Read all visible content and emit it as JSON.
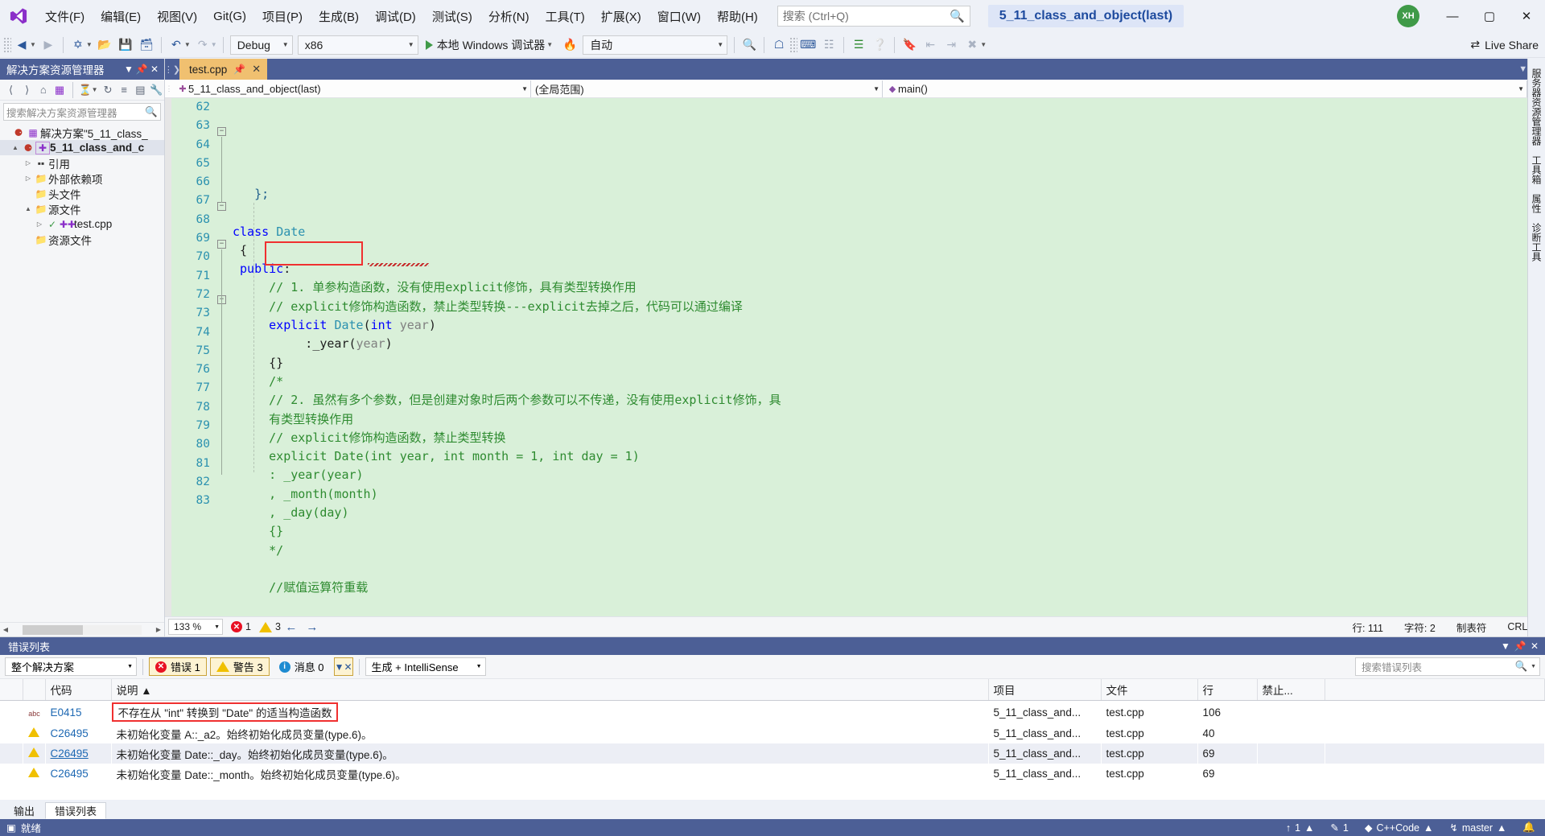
{
  "app": {
    "project_title": "5_11_class_and_object(last)",
    "avatar_initials": "XH"
  },
  "menu": {
    "items": [
      "文件(F)",
      "编辑(E)",
      "视图(V)",
      "Git(G)",
      "项目(P)",
      "生成(B)",
      "调试(D)",
      "测试(S)",
      "分析(N)",
      "工具(T)",
      "扩展(X)",
      "窗口(W)",
      "帮助(H)"
    ],
    "search_placeholder": "搜索 (Ctrl+Q)"
  },
  "window_controls": {
    "minimize": "—",
    "maximize": "▢",
    "close": "✕"
  },
  "toolbar": {
    "configuration": "Debug",
    "platform": "x86",
    "run_label": "本地 Windows 调试器",
    "process": "自动",
    "live_share": "Live Share"
  },
  "solution_explorer": {
    "title": "解决方案资源管理器",
    "search_placeholder": "搜索解决方案资源管理器",
    "tree": [
      {
        "label": "解决方案\"5_11_class_",
        "icon": "solution-icon",
        "indent": 0,
        "expander": "",
        "bold": false,
        "selected": false
      },
      {
        "label": "5_11_class_and_c",
        "icon": "project-icon",
        "indent": 1,
        "expander": "▲",
        "bold": true,
        "selected": true
      },
      {
        "label": "引用",
        "icon": "references-icon",
        "indent": 2,
        "expander": "▷",
        "bold": false,
        "selected": false
      },
      {
        "label": "外部依赖项",
        "icon": "folder-dep-icon",
        "indent": 2,
        "expander": "▷",
        "bold": false,
        "selected": false
      },
      {
        "label": "头文件",
        "icon": "filter-folder-icon",
        "indent": 2,
        "expander": "",
        "bold": false,
        "selected": false
      },
      {
        "label": "源文件",
        "icon": "filter-folder-icon",
        "indent": 2,
        "expander": "▲",
        "bold": false,
        "selected": false
      },
      {
        "label": "test.cpp",
        "icon": "cpp-file-icon",
        "indent": 3,
        "expander": "▷",
        "bold": false,
        "selected": false
      },
      {
        "label": "资源文件",
        "icon": "filter-folder-icon",
        "indent": 2,
        "expander": "",
        "bold": false,
        "selected": false
      }
    ]
  },
  "editor": {
    "tab_label": "test.cpp",
    "nav_project": "5_11_class_and_object(last)",
    "nav_scope": "(全局范围)",
    "nav_member": "main()",
    "zoom": "133 %",
    "error_count": "1",
    "warning_count": "3",
    "status_line": "行: 111",
    "status_col": "字符: 2",
    "status_tabs": "制表符",
    "status_eol": "CRLF",
    "lines": [
      {
        "num": "62",
        "html": "   <span class='mem'>};</span>"
      },
      {
        "num": "63",
        "html": ""
      },
      {
        "num": "64",
        "html": "<span class='kw'>class</span> <span class='kw2'>Date</span>"
      },
      {
        "num": "65",
        "html": " {"
      },
      {
        "num": "66",
        "html": " <span class='kw'>public</span>:"
      },
      {
        "num": "67",
        "html": "     <span class='cmt'>// 1. 单参构造函数，没有使用explicit修饰，具有类型转换作用</span>"
      },
      {
        "num": "68",
        "html": "     <span class='cmt'>// explicit修饰构造函数，禁止类型转换---explicit去掉之后，代码可以通过编译</span>"
      },
      {
        "num": "69",
        "html": "     <span class='kw'>explicit</span> <span class='kw2'>Date</span>(<span class='kw'>int</span> <span class='param'>year</span>)"
      },
      {
        "num": "70",
        "html": "          :_year(<span class='param'>year</span>)"
      },
      {
        "num": "71",
        "html": "     {}"
      },
      {
        "num": "72",
        "html": "     <span class='cmt'>/*</span>"
      },
      {
        "num": "73",
        "html": "     <span class='cmt'>// 2. 虽然有多个参数，但是创建对象时后两个参数可以不传递，没有使用explicit修饰，具</span>"
      },
      {
        "num": "74",
        "html": "     <span class='cmt'>有类型转换作用</span>"
      },
      {
        "num": "75",
        "html": "     <span class='cmt'>// explicit修饰构造函数，禁止类型转换</span>"
      },
      {
        "num": "76",
        "html": "     <span class='cmt'>explicit Date(int year, int month = 1, int day = 1)</span>"
      },
      {
        "num": "77",
        "html": "     <span class='cmt'>: _year(year)</span>"
      },
      {
        "num": "78",
        "html": "     <span class='cmt'>, _month(month)</span>"
      },
      {
        "num": "79",
        "html": "     <span class='cmt'>, _day(day)</span>"
      },
      {
        "num": "80",
        "html": "     <span class='cmt'>{}</span>"
      },
      {
        "num": "81",
        "html": "     <span class='cmt'>*/</span>"
      },
      {
        "num": "82",
        "html": ""
      },
      {
        "num": "83",
        "html": "     <span class='cmt'>//赋值运算符重载</span>"
      }
    ]
  },
  "error_list": {
    "title": "错误列表",
    "scope": "整个解决方案",
    "errors_label": "错误 1",
    "warnings_label": "警告 3",
    "messages_label": "消息 0",
    "build_filter": "生成 + IntelliSense",
    "search_placeholder": "搜索错误列表",
    "columns": [
      "",
      "",
      "代码",
      "说明 ▲",
      "项目",
      "文件",
      "行",
      "禁止..."
    ],
    "rows": [
      {
        "severity": "intellisense",
        "code": "E0415",
        "code_underlined": false,
        "description": "不存在从 \"int\" 转换到 \"Date\" 的适当构造函数",
        "highlighted": true,
        "project": "5_11_class_and...",
        "file": "test.cpp",
        "line": "106",
        "suppress": "",
        "selected": false
      },
      {
        "severity": "warning",
        "code": "C26495",
        "code_underlined": false,
        "description": "未初始化变量 A::_a2。始终初始化成员变量(type.6)。",
        "highlighted": false,
        "project": "5_11_class_and...",
        "file": "test.cpp",
        "line": "40",
        "suppress": "",
        "selected": false
      },
      {
        "severity": "warning",
        "code": "C26495",
        "code_underlined": true,
        "description": "未初始化变量 Date::_day。始终初始化成员变量(type.6)。",
        "highlighted": false,
        "project": "5_11_class_and...",
        "file": "test.cpp",
        "line": "69",
        "suppress": "",
        "selected": true
      },
      {
        "severity": "warning",
        "code": "C26495",
        "code_underlined": false,
        "description": "未初始化变量 Date::_month。始终初始化成员变量(type.6)。",
        "highlighted": false,
        "project": "5_11_class_and...",
        "file": "test.cpp",
        "line": "69",
        "suppress": "",
        "selected": false
      }
    ],
    "tabs": [
      {
        "label": "输出",
        "active": false
      },
      {
        "label": "错误列表",
        "active": true
      }
    ]
  },
  "right_dock": [
    "服务器资源管理器",
    "工具箱",
    "属性",
    "诊断工具"
  ],
  "status_bar": {
    "ready": "就绪",
    "pending_changes": "1",
    "edits": "1",
    "source_control_repo": "C++Code",
    "branch": "master"
  },
  "colors": {
    "accent": "#4c5f96",
    "tab_active": "#f0c070",
    "code_bg": "#d9f0d9",
    "error_red": "#e81123",
    "warning_yellow": "#f0c000",
    "highlight_box": "#f03030",
    "changebar_green": "#5ae05a",
    "link_blue": "#1d68b3"
  }
}
